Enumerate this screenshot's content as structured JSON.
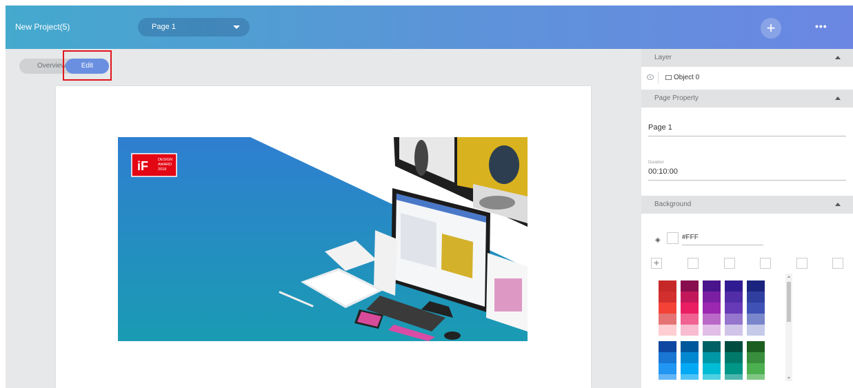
{
  "header": {
    "project_title": "New Project(5)",
    "page_select_value": "Page 1",
    "add_label": "+",
    "more_label": "•••"
  },
  "view_toggle": {
    "overview_label": "Overview",
    "edit_label": "Edit",
    "active": "Edit"
  },
  "banner": {
    "badge_logo": "iF",
    "badge_lines": [
      "DESIGN",
      "AWARD",
      "2018"
    ]
  },
  "panel": {
    "layer": {
      "header": "Layer",
      "item_label": "Object 0"
    },
    "page_property": {
      "header": "Page Property",
      "page_name": "Page 1",
      "duration_label": "Duration",
      "duration_value": "00:10:00"
    },
    "background": {
      "header": "Background",
      "color_value": "#FFF",
      "palette_top": [
        [
          "#c62828",
          "#d32f2f",
          "#f44336",
          "#e57373",
          "#ffcdd2"
        ],
        [
          "#880e4f",
          "#c2185b",
          "#e91e63",
          "#f06292",
          "#f8bbd0"
        ],
        [
          "#4a148c",
          "#7b1fa2",
          "#9c27b0",
          "#ba68c8",
          "#e1bee7"
        ],
        [
          "#311b92",
          "#512da8",
          "#673ab7",
          "#9575cd",
          "#d1c4e9"
        ],
        [
          "#1a237e",
          "#303f9f",
          "#3f51b5",
          "#7986cb",
          "#c5cae9"
        ]
      ],
      "palette_bottom": [
        [
          "#0d47a1",
          "#1976d2",
          "#2196f3",
          "#64b5f6"
        ],
        [
          "#01579b",
          "#0288d1",
          "#03a9f4",
          "#4fc3f7"
        ],
        [
          "#006064",
          "#0097a7",
          "#00bcd4",
          "#4dd0e1"
        ],
        [
          "#004d40",
          "#00796b",
          "#009688",
          "#4db6ac"
        ],
        [
          "#1b5e20",
          "#388e3c",
          "#4caf50",
          "#81c784"
        ]
      ]
    }
  }
}
